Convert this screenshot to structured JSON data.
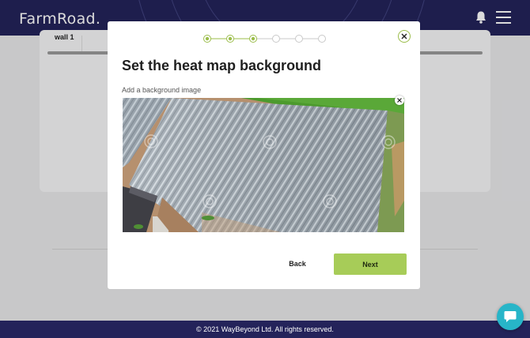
{
  "app": {
    "brand": "FarmRoad."
  },
  "header": {
    "bell_icon": "bell-icon",
    "menu_icon": "hamburger-menu-icon"
  },
  "background": {
    "wall_label": "wall 1"
  },
  "modal": {
    "title": "Set the heat map background",
    "subtitle": "Add a background image",
    "close_icon": "close-icon",
    "image": {
      "description_icon": "greenhouse-aerial-photo",
      "remove_icon": "close-icon"
    },
    "stepper": {
      "total_steps": 6,
      "completed_steps": 3,
      "steps": [
        {
          "status": "done"
        },
        {
          "status": "done"
        },
        {
          "status": "done"
        },
        {
          "status": "pending"
        },
        {
          "status": "pending"
        },
        {
          "status": "pending"
        }
      ]
    },
    "actions": {
      "back_label": "Back",
      "next_label": "Next"
    }
  },
  "footer": {
    "copyright": "© 2021 WayBeyond Ltd. All rights reserved."
  },
  "chat": {
    "icon": "chat-bubble-icon"
  },
  "colors": {
    "header_bg": "#24235a",
    "accent_green": "#a7cc58",
    "step_done": "#9bbd4a",
    "step_pending": "#c9c9c9",
    "chat_bg": "#27b5c8"
  }
}
